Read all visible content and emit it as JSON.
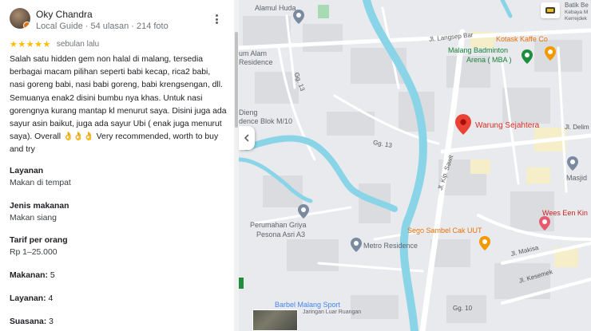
{
  "review": {
    "reviewer_name": "Oky Chandra",
    "reviewer_meta": "Local Guide · 54 ulasan · 214 foto",
    "stars": "★★★★★",
    "rating": 5,
    "time_ago": "sebulan lalu",
    "text": "Salah satu hidden gem non halal di malang, tersedia berbagai macam pilihan seperti babi kecap, rica2 babi, nasi goreng babi, nasi babi goreng, babi krengsengan, dll. Semuanya enak2 disini bumbu nya khas. Untuk nasi gorengnya kurang mantap kl menurut saya. Disini juga ada sayur asin baikut, juga ada sayur Ubi ( enak juga menurut saya). Overall 👌👌👌 Very recommended, worth to buy and try",
    "attributes": [
      {
        "key": "Layanan",
        "value": "Makan di tempat"
      },
      {
        "key": "Jenis makanan",
        "value": "Makan siang"
      },
      {
        "key": "Tarif per orang",
        "value": "Rp 1–25.000"
      }
    ],
    "scores": [
      {
        "key": "Makanan",
        "value": "5"
      },
      {
        "key": "Layanan",
        "value": "4"
      },
      {
        "key": "Suasana",
        "value": "3"
      }
    ]
  },
  "map": {
    "labels": {
      "alamul_huda": "Alamul Huda",
      "langsep_bar": "Jl. Langsep Bar",
      "kotask": "Kotask Kaffe Co",
      "malang_badminton": "Malang Badminton",
      "arena_mba": "Arena ( MBA )",
      "alam_residence_1": "um Alam",
      "alam_residence_2": "Residence",
      "gg13_a": "Gg. 13",
      "griya_1": "Dieng",
      "griya_2": "dence Blok M/10",
      "warung": "Warung Sejahtera",
      "delima": "Jl. Delim",
      "gg13_b": "Gg. 13",
      "kip_sawit": "Jl. Kip. Sawit",
      "masjid": "Masjid",
      "wees": "Wees Een Kin",
      "perumahan_1": "Perumahan Griya",
      "perumahan_2": "Pesona Asri A3",
      "sego_sambel": "Sego Sambel Cak UUT",
      "metro": "Metro Residence",
      "makisa": "Jl. Makisa",
      "kesemek": "Jl. Kesemek",
      "barbel_1": "Barbel Malang Sport",
      "barbel_2": "Jaringan Luar Ruangan",
      "gg10": "Gg. 10",
      "batik_1": "Batik Be",
      "batik_2": "Kebaya M",
      "batik_3": "Kerrejdek"
    }
  }
}
